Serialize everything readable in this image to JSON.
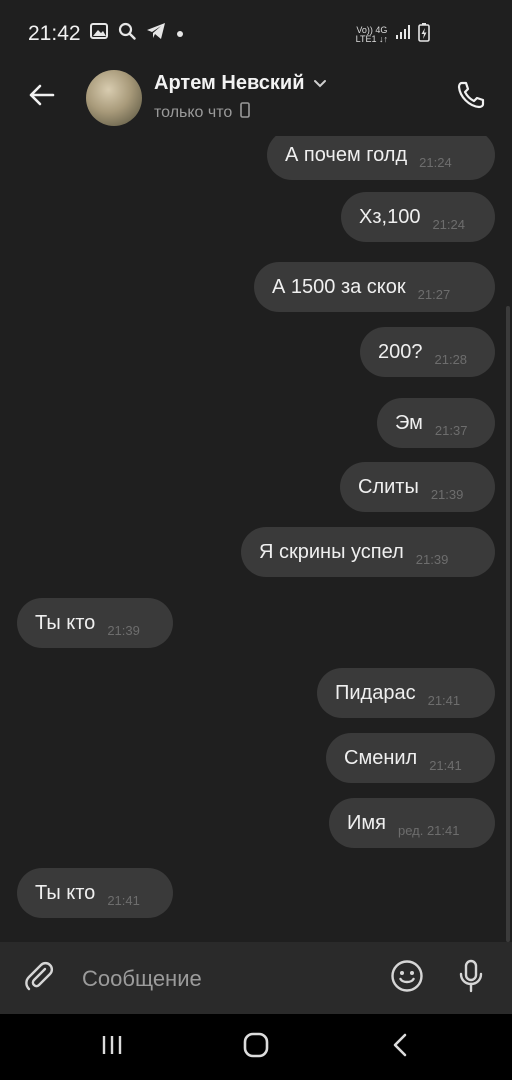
{
  "status_bar": {
    "time": "21:42",
    "network_top": "Vo)) 4G",
    "network_bottom": "LTE1 ↓↑",
    "icons": [
      "image-icon",
      "search-icon",
      "telegram-icon",
      "dot-icon",
      "signal-icon",
      "battery-charging-icon"
    ]
  },
  "header": {
    "contact_name": "Артем Невский",
    "status": "только что",
    "icons": [
      "back-arrow-icon",
      "chevron-down-icon",
      "phone-device-icon",
      "call-icon"
    ]
  },
  "messages": [
    {
      "side": "out",
      "text": "А почем голд",
      "time": "21:24"
    },
    {
      "side": "out",
      "text": "Хз,100",
      "time": "21:24"
    },
    {
      "side": "out",
      "text": "А 1500 за скок",
      "time": "21:27"
    },
    {
      "side": "out",
      "text": "200?",
      "time": "21:28"
    },
    {
      "side": "out",
      "text": "Эм",
      "time": "21:37"
    },
    {
      "side": "out",
      "text": "Слиты",
      "time": "21:39"
    },
    {
      "side": "out",
      "text": "Я скрины успел",
      "time": "21:39"
    },
    {
      "side": "in",
      "text": "Ты кто",
      "time": "21:39"
    },
    {
      "side": "out",
      "text": "Пидарас",
      "time": "21:41"
    },
    {
      "side": "out",
      "text": "Сменил",
      "time": "21:41"
    },
    {
      "side": "out",
      "text": "Имя",
      "time": "ред. 21:41"
    },
    {
      "side": "in",
      "text": "Ты кто",
      "time": "21:41"
    }
  ],
  "composer": {
    "placeholder": "Сообщение",
    "icons": [
      "paperclip-icon",
      "emoji-icon",
      "microphone-icon"
    ]
  },
  "navbar": {
    "icons": [
      "recent-apps-icon",
      "home-icon",
      "back-icon"
    ]
  },
  "colors": {
    "background": "#1f1f1f",
    "bubble": "#3a3a3a",
    "text": "#efefef",
    "muted": "#9a9a9a",
    "composer_bg": "#2a2a2a"
  }
}
